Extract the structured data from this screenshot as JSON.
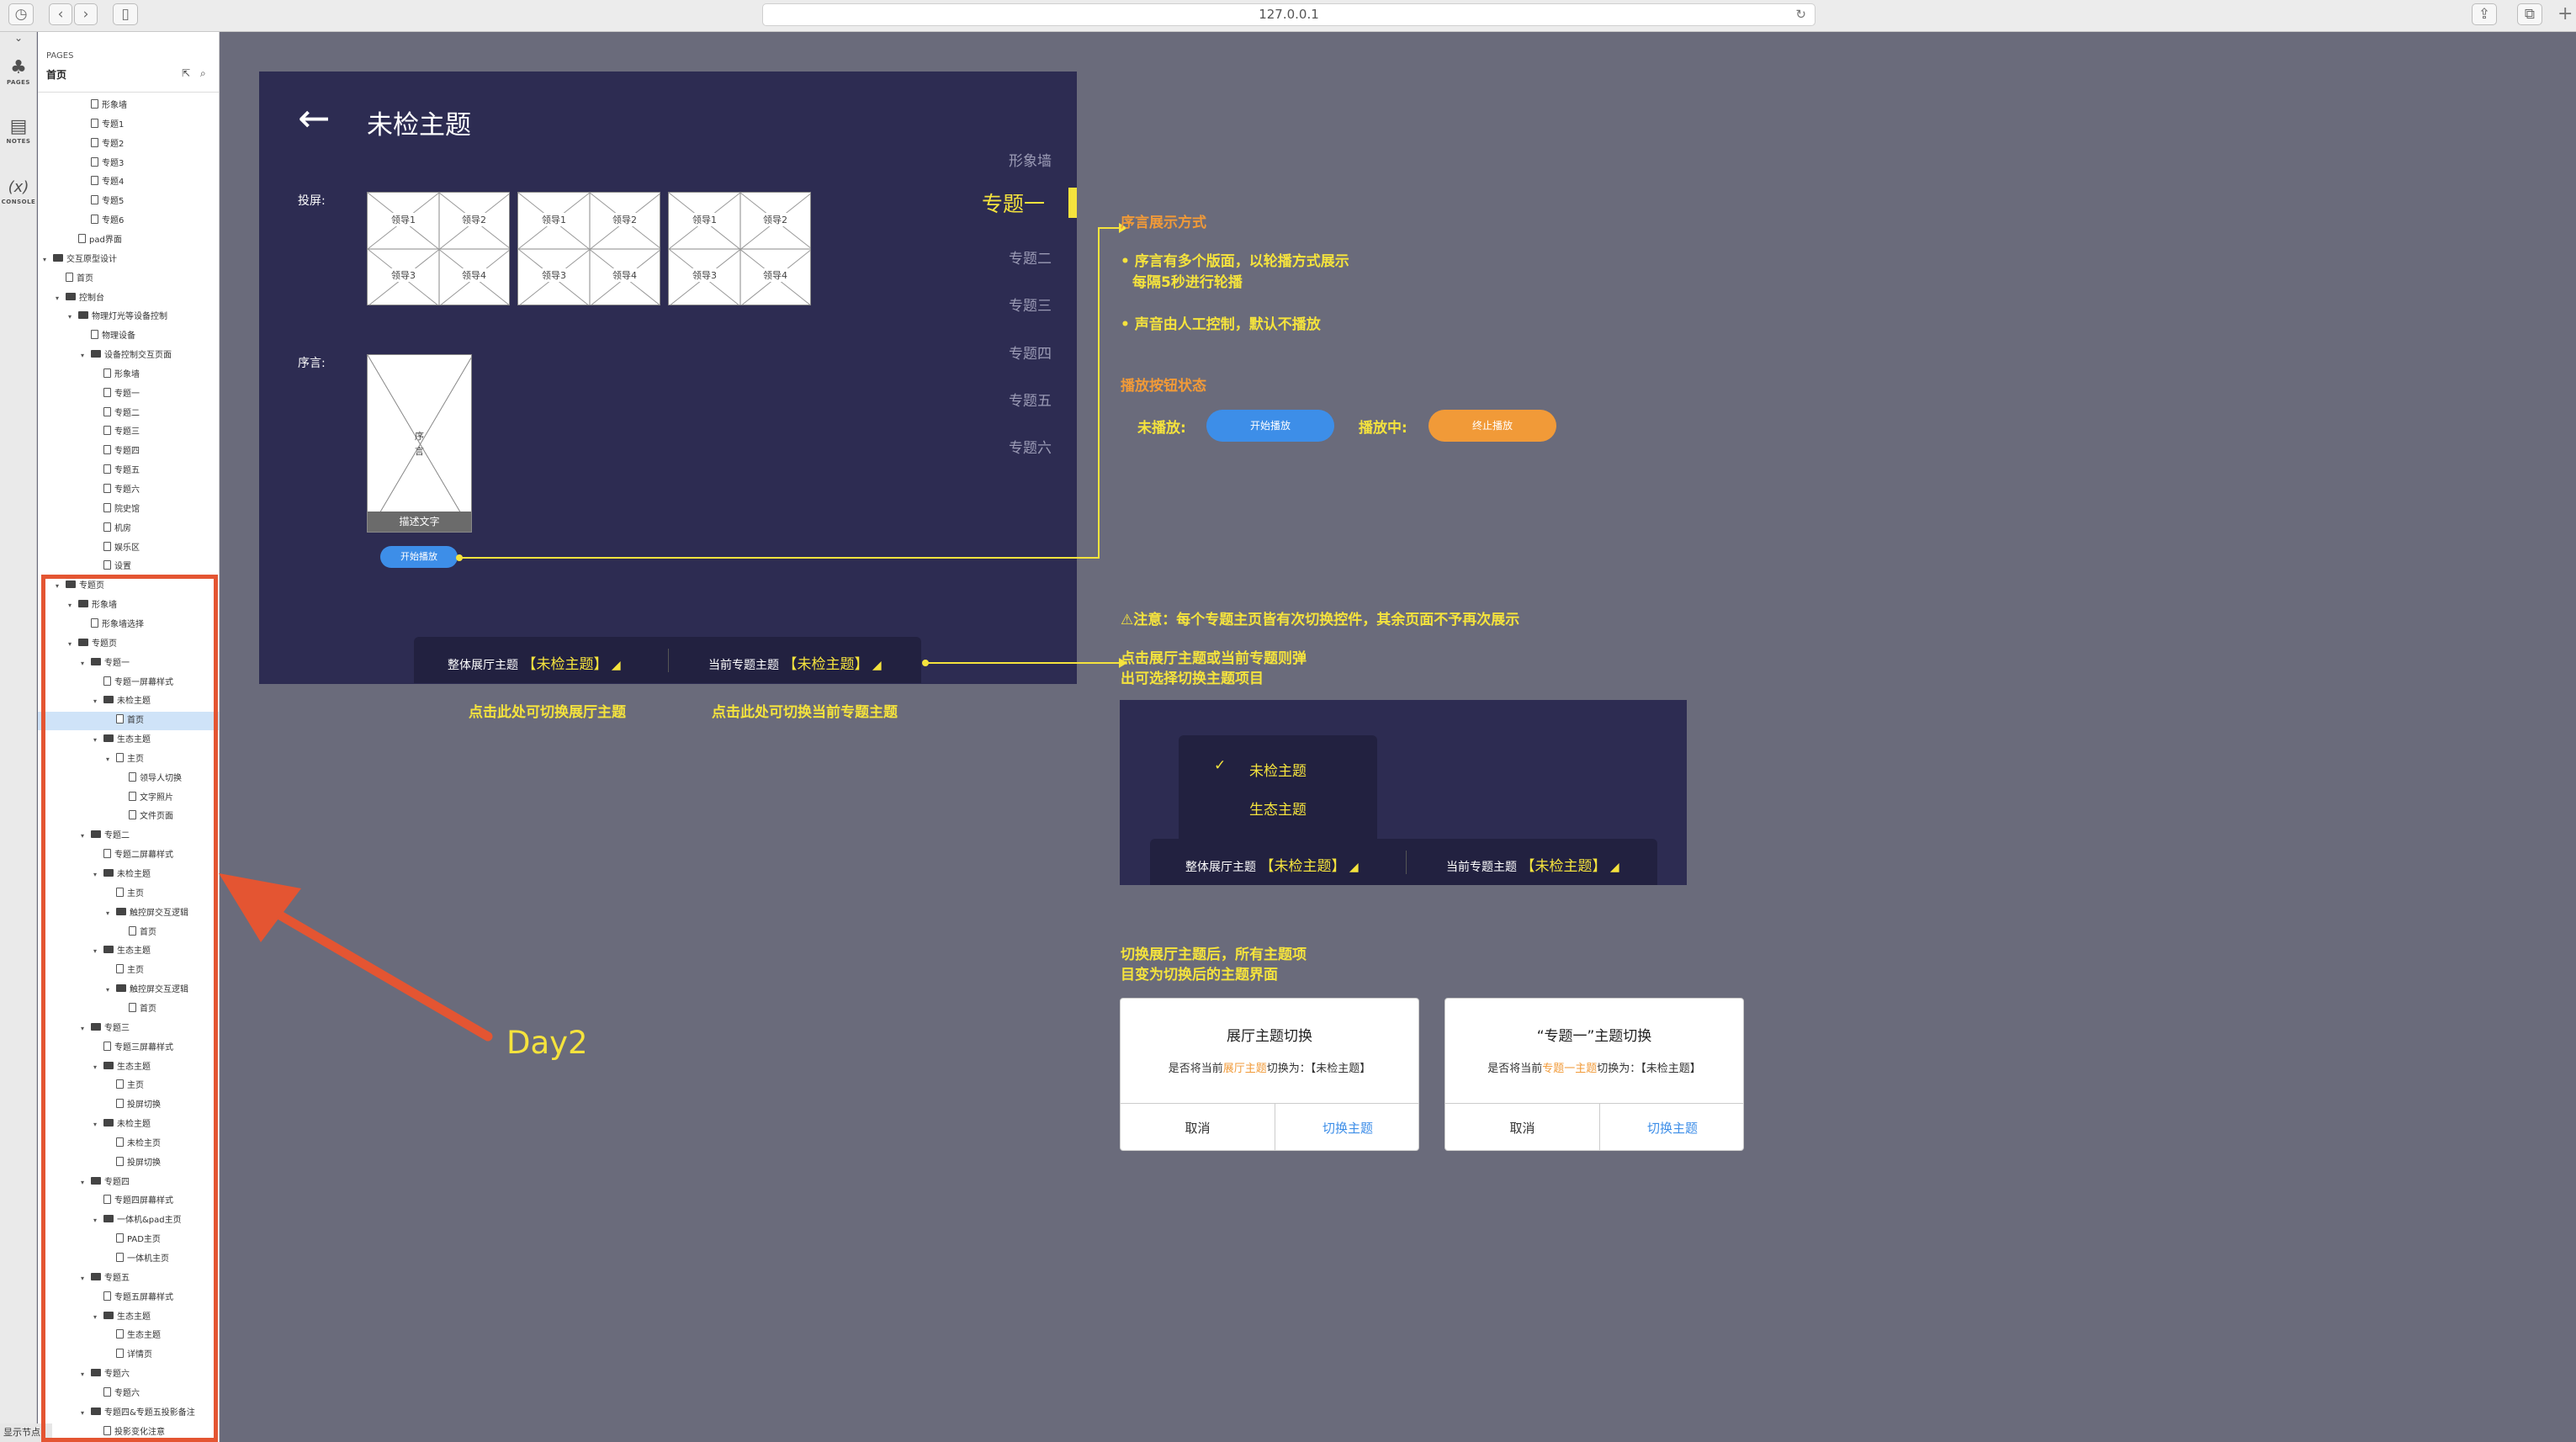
{
  "browser": {
    "url": "127.0.0.1"
  },
  "sidebar_strip": {
    "pages": "PAGES",
    "notes": "NOTES",
    "console": "CONSOLE"
  },
  "tree": {
    "header": "PAGES",
    "current": "首页",
    "nodes": [
      {
        "d": 3,
        "k": "f",
        "t": "形象墙"
      },
      {
        "d": 3,
        "k": "f",
        "t": "专题1"
      },
      {
        "d": 3,
        "k": "f",
        "t": "专题2"
      },
      {
        "d": 3,
        "k": "f",
        "t": "专题3"
      },
      {
        "d": 3,
        "k": "f",
        "t": "专题4"
      },
      {
        "d": 3,
        "k": "f",
        "t": "专题5"
      },
      {
        "d": 3,
        "k": "f",
        "t": "专题6"
      },
      {
        "d": 2,
        "k": "f",
        "t": "pad界面"
      },
      {
        "d": 0,
        "k": "d",
        "t": "交互原型设计"
      },
      {
        "d": 1,
        "k": "f",
        "t": "首页"
      },
      {
        "d": 1,
        "k": "d",
        "t": "控制台"
      },
      {
        "d": 2,
        "k": "d",
        "t": "物理灯光等设备控制"
      },
      {
        "d": 3,
        "k": "f",
        "t": "物理设备"
      },
      {
        "d": 3,
        "k": "d",
        "t": "设备控制交互页面"
      },
      {
        "d": 4,
        "k": "f",
        "t": "形象墙"
      },
      {
        "d": 4,
        "k": "f",
        "t": "专题一"
      },
      {
        "d": 4,
        "k": "f",
        "t": "专题二"
      },
      {
        "d": 4,
        "k": "f",
        "t": "专题三"
      },
      {
        "d": 4,
        "k": "f",
        "t": "专题四"
      },
      {
        "d": 4,
        "k": "f",
        "t": "专题五"
      },
      {
        "d": 4,
        "k": "f",
        "t": "专题六"
      },
      {
        "d": 4,
        "k": "f",
        "t": "院史馆"
      },
      {
        "d": 4,
        "k": "f",
        "t": "机房"
      },
      {
        "d": 4,
        "k": "f",
        "t": "娱乐区"
      },
      {
        "d": 4,
        "k": "f",
        "t": "设置"
      },
      {
        "d": 1,
        "k": "d",
        "t": "专题页"
      },
      {
        "d": 2,
        "k": "d",
        "t": "形象墙"
      },
      {
        "d": 3,
        "k": "f",
        "t": "形象墙选择"
      },
      {
        "d": 2,
        "k": "d",
        "t": "专题页"
      },
      {
        "d": 3,
        "k": "d",
        "t": "专题一"
      },
      {
        "d": 4,
        "k": "f",
        "t": "专题一屏幕样式"
      },
      {
        "d": 4,
        "k": "d",
        "t": "未检主题"
      },
      {
        "d": 5,
        "k": "f",
        "t": "首页",
        "sel": true
      },
      {
        "d": 4,
        "k": "d",
        "t": "生态主题"
      },
      {
        "d": 5,
        "k": "f",
        "t": "主页",
        "open": true
      },
      {
        "d": 6,
        "k": "f",
        "t": "领导人切换"
      },
      {
        "d": 6,
        "k": "f",
        "t": "文字照片"
      },
      {
        "d": 6,
        "k": "f",
        "t": "文件页面"
      },
      {
        "d": 3,
        "k": "d",
        "t": "专题二"
      },
      {
        "d": 4,
        "k": "f",
        "t": "专题二屏幕样式"
      },
      {
        "d": 4,
        "k": "d",
        "t": "未检主题"
      },
      {
        "d": 5,
        "k": "f",
        "t": "主页"
      },
      {
        "d": 5,
        "k": "d",
        "t": "触控屏交互逻辑"
      },
      {
        "d": 6,
        "k": "f",
        "t": "首页"
      },
      {
        "d": 4,
        "k": "d",
        "t": "生态主题"
      },
      {
        "d": 5,
        "k": "f",
        "t": "主页"
      },
      {
        "d": 5,
        "k": "d",
        "t": "触控屏交互逻辑"
      },
      {
        "d": 6,
        "k": "f",
        "t": "首页"
      },
      {
        "d": 3,
        "k": "d",
        "t": "专题三"
      },
      {
        "d": 4,
        "k": "f",
        "t": "专题三屏幕样式"
      },
      {
        "d": 4,
        "k": "d",
        "t": "生态主题"
      },
      {
        "d": 5,
        "k": "f",
        "t": "主页"
      },
      {
        "d": 5,
        "k": "f",
        "t": "投屏切换"
      },
      {
        "d": 4,
        "k": "d",
        "t": "未检主题"
      },
      {
        "d": 5,
        "k": "f",
        "t": "未检主页"
      },
      {
        "d": 5,
        "k": "f",
        "t": "投屏切换"
      },
      {
        "d": 3,
        "k": "d",
        "t": "专题四"
      },
      {
        "d": 4,
        "k": "f",
        "t": "专题四屏幕样式"
      },
      {
        "d": 4,
        "k": "d",
        "t": "一体机&pad主页"
      },
      {
        "d": 5,
        "k": "f",
        "t": "PAD主页"
      },
      {
        "d": 5,
        "k": "f",
        "t": "一体机主页"
      },
      {
        "d": 3,
        "k": "d",
        "t": "专题五"
      },
      {
        "d": 4,
        "k": "f",
        "t": "专题五屏幕样式"
      },
      {
        "d": 4,
        "k": "d",
        "t": "生态主题"
      },
      {
        "d": 5,
        "k": "f",
        "t": "生态主题"
      },
      {
        "d": 5,
        "k": "f",
        "t": "详情页"
      },
      {
        "d": 3,
        "k": "d",
        "t": "专题六"
      },
      {
        "d": 4,
        "k": "f",
        "t": "专题六"
      },
      {
        "d": 3,
        "k": "d",
        "t": "专题四&专题五投影备注"
      },
      {
        "d": 4,
        "k": "f",
        "t": "投影变化注意"
      }
    ],
    "footer": "显示节点"
  },
  "annotation": {
    "day": "Day2"
  },
  "wireframe": {
    "title": "未检主题",
    "projection_label": "投屏:",
    "leaders": [
      [
        "领导1",
        "领导2",
        "领导3",
        "领导4"
      ],
      [
        "领导1",
        "领导2",
        "领导3",
        "领导4"
      ],
      [
        "领导1",
        "领导2",
        "领导3",
        "领导4"
      ]
    ],
    "preface_label": "序言:",
    "preface_placeholder": [
      "序",
      "言"
    ],
    "preface_caption": "描述文字",
    "play_button": "开始播放",
    "nav": [
      "形象墙",
      "专题一",
      "专题二",
      "专题三",
      "专题四",
      "专题五",
      "专题六"
    ],
    "nav_active": "专题一",
    "dropdown_bar": {
      "hall_label": "整体展厅主题",
      "hall_value": "【未检主题】",
      "topic_label": "当前专题主题",
      "topic_value": "【未检主题】"
    },
    "hint_hall": "点击此处可切换展厅主题",
    "hint_topic": "点击此处可切换当前专题主题"
  },
  "notes": {
    "preface_title": "序言展示方式",
    "preface_1a": "• 序言有多个版面，以轮播方式展示",
    "preface_1b": "每隔5秒进行轮播",
    "preface_2": "• 声音由人工控制，默认不播放",
    "play_state_title": "播放按钮状态",
    "not_playing_label": "未播放:",
    "not_playing_btn": "开始播放",
    "playing_label": "播放中:",
    "playing_btn": "终止播放",
    "warning": "⚠注意：每个专题主页皆有次切换控件，其余页面不予再次展示",
    "popup_note_1": "点击展厅主题或当前专题则弹",
    "popup_note_2": "出可选择切换主题项目",
    "switch_note_1": "切换展厅主题后，所有主题项",
    "switch_note_2": "目变为切换后的主题界面"
  },
  "popup_demo": {
    "options": [
      "未检主题",
      "生态主题"
    ],
    "checked": "未检主题",
    "hall_label": "整体展厅主题",
    "hall_value": "【未检主题】",
    "topic_label": "当前专题主题",
    "topic_value": "【未检主题】"
  },
  "dialogs": [
    {
      "title": "展厅主题切换",
      "msg_pre": "是否将当前",
      "msg_hl": "展厅主题",
      "msg_post": "切换为：【未检主题】",
      "cancel": "取消",
      "ok": "切换主题"
    },
    {
      "title": "“专题一”主题切换",
      "msg_pre": "是否将当前",
      "msg_hl": "专题一主题",
      "msg_post": "切换为：【未检主题】",
      "cancel": "取消",
      "ok": "切换主题"
    }
  ],
  "colors": {
    "panel": "#2d2c52",
    "canvas": "#6a6b7b",
    "accent_yellow": "#f5e33d",
    "accent_orange": "#f19a38",
    "blue": "#3d8ee8",
    "red_annotation": "#e45532"
  }
}
